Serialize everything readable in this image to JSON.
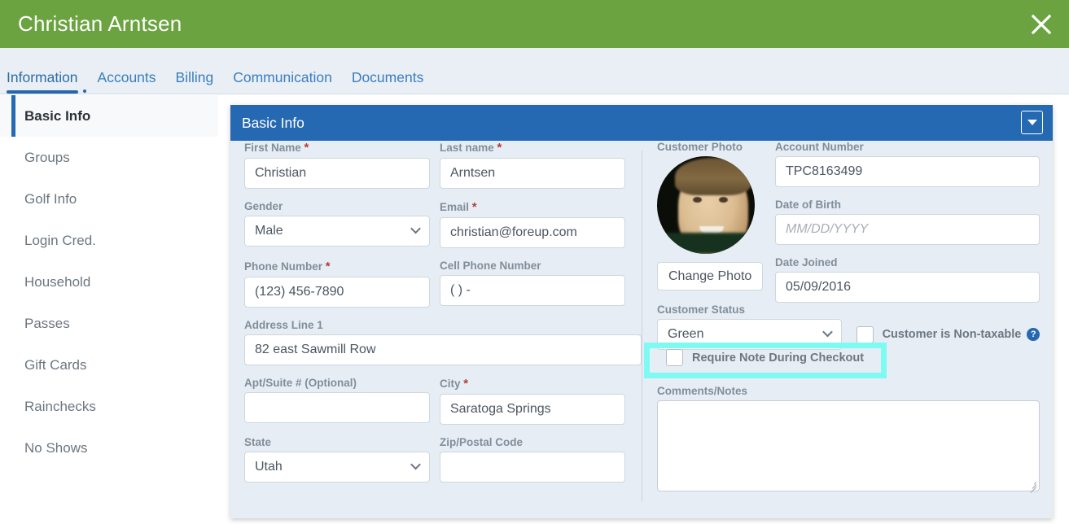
{
  "window": {
    "title": "Christian Arntsen",
    "close_icon": "close-icon",
    "header_color": "#6aa340"
  },
  "tabs": [
    {
      "label": "Information",
      "active": true
    },
    {
      "label": "Accounts",
      "active": false
    },
    {
      "label": "Billing",
      "active": false
    },
    {
      "label": "Communication",
      "active": false
    },
    {
      "label": "Documents",
      "active": false
    }
  ],
  "sidebar": {
    "items": [
      {
        "label": "Basic Info",
        "active": true
      },
      {
        "label": "Groups",
        "active": false
      },
      {
        "label": "Golf Info",
        "active": false
      },
      {
        "label": "Login Cred.",
        "active": false
      },
      {
        "label": "Household",
        "active": false
      },
      {
        "label": "Passes",
        "active": false
      },
      {
        "label": "Gift Cards",
        "active": false
      },
      {
        "label": "Rainchecks",
        "active": false
      },
      {
        "label": "No Shows",
        "active": false
      }
    ]
  },
  "panel": {
    "title": "Basic Info",
    "header_color": "#2569b2",
    "toggle_icon": "chevron-down-icon"
  },
  "form": {
    "first_name": {
      "label": "First Name",
      "required": true,
      "value": "Christian"
    },
    "last_name": {
      "label": "Last name",
      "required": true,
      "value": "Arntsen"
    },
    "gender": {
      "label": "Gender",
      "required": false,
      "value": "Male"
    },
    "email": {
      "label": "Email",
      "required": true,
      "value": "christian@foreup.com"
    },
    "phone": {
      "label": "Phone Number",
      "required": true,
      "value": "(123) 456-7890"
    },
    "cell_phone": {
      "label": "Cell Phone Number",
      "required": false,
      "value": "(  )    -"
    },
    "address1": {
      "label": "Address Line 1",
      "required": false,
      "value": "82 east Sawmill Row"
    },
    "apt": {
      "label": "Apt/Suite # (Optional)",
      "required": false,
      "value": ""
    },
    "city": {
      "label": "City",
      "required": true,
      "value": "Saratoga Springs"
    },
    "state": {
      "label": "State",
      "required": false,
      "value": "Utah"
    },
    "zip": {
      "label": "Zip/Postal Code",
      "required": false,
      "value": ""
    },
    "customer_photo": {
      "label": "Customer Photo",
      "change_button": "Change Photo"
    },
    "account_number": {
      "label": "Account Number",
      "required": false,
      "value": "TPC8163499"
    },
    "date_of_birth": {
      "label": "Date of Birth",
      "required": false,
      "value": "",
      "placeholder": "MM/DD/YYYY"
    },
    "date_joined": {
      "label": "Date Joined",
      "required": false,
      "value": "05/09/2016"
    },
    "customer_status": {
      "label": "Customer Status",
      "required": false,
      "value": "Green"
    },
    "non_taxable": {
      "label": "Customer is Non-taxable",
      "checked": false,
      "help_icon": "help-icon"
    },
    "require_note": {
      "label": "Require Note During Checkout",
      "checked": false,
      "highlight_color": "#7dfaf2"
    },
    "comments": {
      "label": "Comments/Notes",
      "value": ""
    }
  }
}
